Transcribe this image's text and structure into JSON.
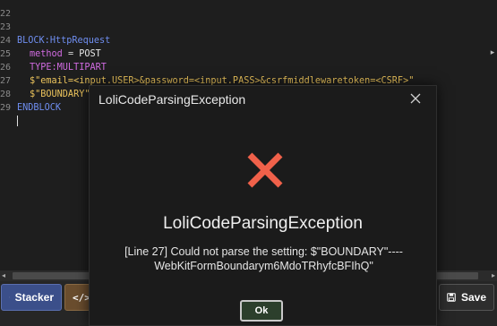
{
  "editor": {
    "lines": [
      {
        "num": "22",
        "text": ""
      },
      {
        "num": "23",
        "block_keyword": "BLOCK:",
        "block_name": "HttpRequest"
      },
      {
        "num": "24",
        "property": "method",
        "eq": " = ",
        "value": "POST"
      },
      {
        "num": "25",
        "type_label": "TYPE:MULTIPART"
      },
      {
        "num": "26",
        "content": "$\"email=<input.USER>&password=<input.PASS>&csrfmiddlewaretoken=<CSRF>\""
      },
      {
        "num": "27",
        "content": "$\"BOUNDARY\"----WebKitFormBoundarym6MdoTRhyfcBFIhQ\""
      },
      {
        "num": "28",
        "end_keyword": "ENDBLOCK"
      },
      {
        "num": "29",
        "text": ""
      }
    ],
    "scroll_arrow": "▸"
  },
  "toolbar": {
    "stacker_label": "Stacker",
    "lolicode_label": "",
    "save_label": "Save"
  },
  "dialog": {
    "title": "LoliCodeParsingException",
    "heading": "LoliCodeParsingException",
    "message_line1": "[Line 27] Could not parse the setting: $\"BOUNDARY\"----",
    "message_line2": "WebKitFormBoundarym6MdoTRhyfcBFIhQ\"",
    "ok_label": "Ok",
    "error_color": "#f0614a"
  }
}
